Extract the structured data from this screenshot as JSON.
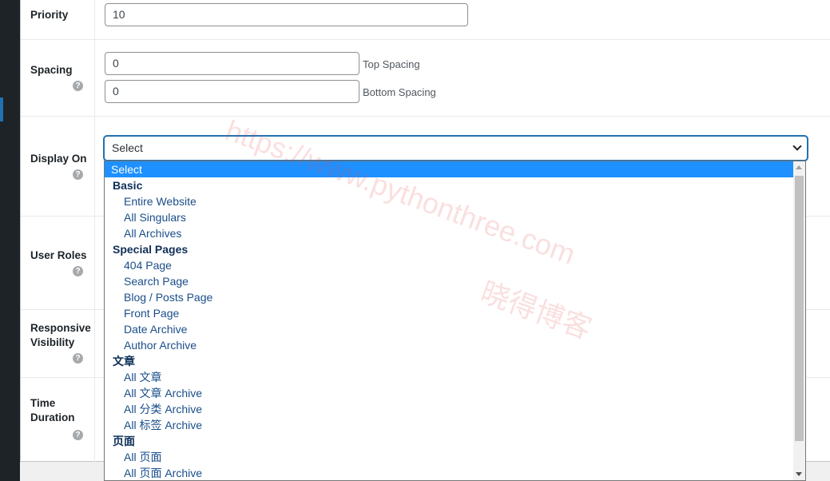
{
  "fields": {
    "priority": {
      "label": "Priority",
      "value": "10"
    },
    "spacing": {
      "label": "Spacing",
      "top_value": "0",
      "top_label": "Top Spacing",
      "bottom_value": "0",
      "bottom_label": "Bottom Spacing"
    },
    "display_on": {
      "label": "Display On",
      "selected": "Select"
    },
    "user_roles": {
      "label": "User Roles"
    },
    "responsive": {
      "label_1": "Responsive",
      "label_2": "Visibility"
    },
    "time_duration": {
      "label_1": "Time",
      "label_2": "Duration"
    },
    "help_glyph": "?"
  },
  "dropdown": {
    "options": [
      {
        "type": "selected",
        "label": "Select"
      },
      {
        "type": "group",
        "label": "Basic"
      },
      {
        "type": "option",
        "label": "Entire Website"
      },
      {
        "type": "option",
        "label": "All Singulars"
      },
      {
        "type": "option",
        "label": "All Archives"
      },
      {
        "type": "group",
        "label": "Special Pages"
      },
      {
        "type": "option",
        "label": "404 Page"
      },
      {
        "type": "option",
        "label": "Search Page"
      },
      {
        "type": "option",
        "label": "Blog / Posts Page"
      },
      {
        "type": "option",
        "label": "Front Page"
      },
      {
        "type": "option",
        "label": "Date Archive"
      },
      {
        "type": "option",
        "label": "Author Archive"
      },
      {
        "type": "group",
        "label": "文章"
      },
      {
        "type": "option",
        "label": "All 文章"
      },
      {
        "type": "option",
        "label": "All 文章 Archive"
      },
      {
        "type": "option",
        "label": "All 分类 Archive"
      },
      {
        "type": "option",
        "label": "All 标签 Archive"
      },
      {
        "type": "group",
        "label": "页面"
      },
      {
        "type": "option",
        "label": "All 页面"
      },
      {
        "type": "option",
        "label": "All 页面 Archive"
      }
    ]
  },
  "watermark": {
    "url": "https://www.pythonthree.com",
    "name": "晓得博客"
  }
}
